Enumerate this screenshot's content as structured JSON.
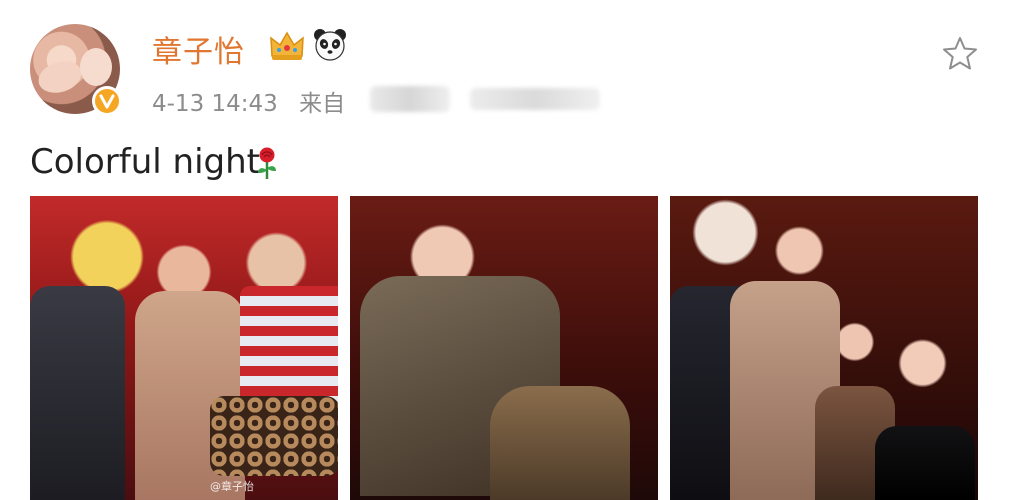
{
  "post": {
    "username": "章子怡",
    "badges": [
      "crown-icon",
      "panda-icon"
    ],
    "timestamp": "4-13 14:43",
    "source_prefix": "来自",
    "text": "Colorful night",
    "text_emoji": "rose-icon",
    "photo_watermark": "@章子怡"
  },
  "colors": {
    "username": "#e0762f",
    "meta": "#8c8c8c",
    "verified_badge": "#f5a623"
  }
}
